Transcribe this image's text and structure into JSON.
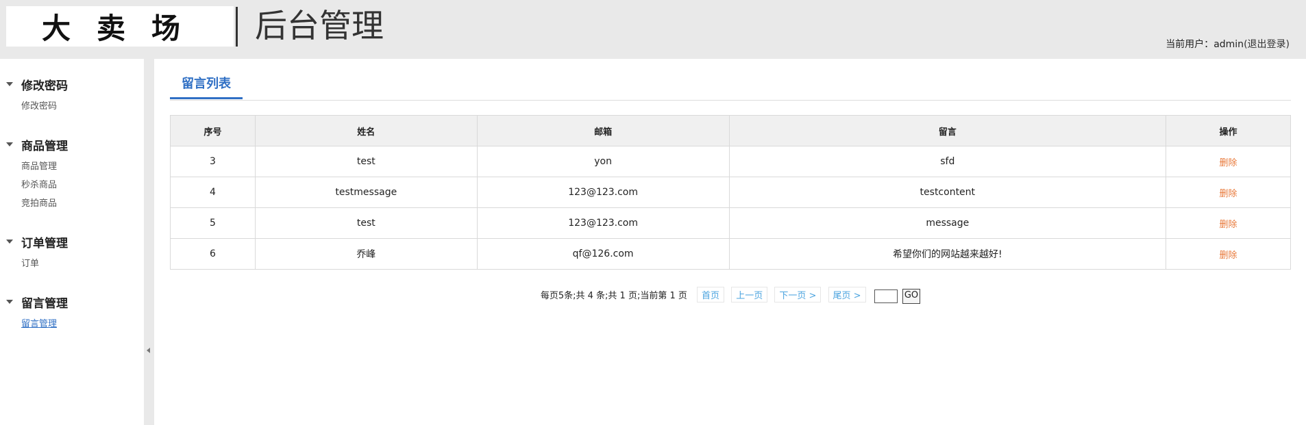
{
  "header": {
    "logo": "大卖场",
    "title": "后台管理",
    "user_label": "当前用户：",
    "user_name": "admin",
    "logout": "(退出登录)"
  },
  "sidebar": {
    "groups": [
      {
        "title": "修改密码",
        "items": [
          "修改密码"
        ]
      },
      {
        "title": "商品管理",
        "items": [
          "商品管理",
          "秒杀商品",
          "竞拍商品"
        ]
      },
      {
        "title": "订单管理",
        "items": [
          "订单"
        ]
      },
      {
        "title": "留言管理",
        "items": [
          "留言管理"
        ]
      }
    ]
  },
  "main": {
    "tab": "留言列表",
    "columns": [
      "序号",
      "姓名",
      "邮箱",
      "留言",
      "操作"
    ],
    "rows": [
      {
        "id": "3",
        "name": "test",
        "email": "yon",
        "message": "sfd",
        "action": "删除"
      },
      {
        "id": "4",
        "name": "testmessage",
        "email": "123@123.com",
        "message": "testcontent",
        "action": "删除"
      },
      {
        "id": "5",
        "name": "test",
        "email": "123@123.com",
        "message": "message",
        "action": "删除"
      },
      {
        "id": "6",
        "name": "乔峰",
        "email": "qf@126.com",
        "message": "希望你们的网站越来越好!",
        "action": "删除"
      }
    ]
  },
  "pager": {
    "info": "每页5条;共 4 条;共 1 页;当前第 1 页",
    "first": "首页",
    "prev": "上一页",
    "next": "下一页 >",
    "last": "尾页 >",
    "go": "GO"
  }
}
